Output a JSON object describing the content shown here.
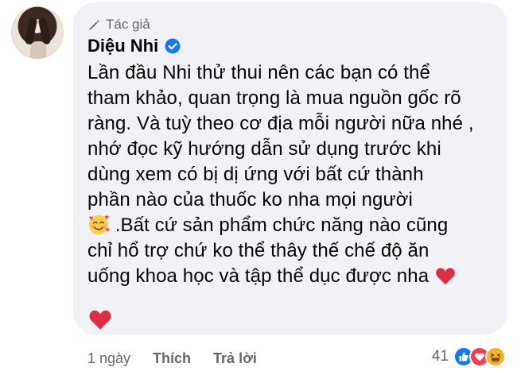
{
  "comment": {
    "author_badge": "Tác giả",
    "author_name": "Diệu Nhi",
    "lines_before_emoji": [
      "Lần đầu Nhi thử thui nên các bạn có thể",
      "tham khảo, quan trọng là mua nguồn gốc rõ",
      "ràng. Và tuỳ theo cơ địa mỗi người nữa nhé ,",
      "nhớ đọc kỹ hướng dẫn sử dụng trước khi",
      "dùng xem có bị dị ứng với bất cứ thành",
      "phần nào của thuốc ko nha mọi người"
    ],
    "line_after_emoji": " .Bất cứ sản phẩm chức năng nào cũng",
    "lines_after": [
      "chỉ hổ trợ chứ ko thể thây thế chế độ ăn",
      "uống khoa học và tập thể dục được nha"
    ],
    "icons": {
      "badge": "pen-icon",
      "verified": "verified-badge-icon",
      "emoji_smile_hearts": "smiling-face-with-hearts-emoji",
      "heart": "red-heart-emoji"
    }
  },
  "actions": {
    "time": "1 ngày",
    "like": "Thích",
    "reply": "Trả lời"
  },
  "reactions": {
    "count": "41",
    "types": [
      "like-reaction-icon",
      "love-reaction-icon",
      "haha-reaction-icon"
    ]
  },
  "colors": {
    "bubble": "#f0f2f5",
    "secondary_text": "#65676b",
    "primary_text": "#050505",
    "facebook_blue": "#1877f2",
    "heart_red": "#f33e58"
  }
}
